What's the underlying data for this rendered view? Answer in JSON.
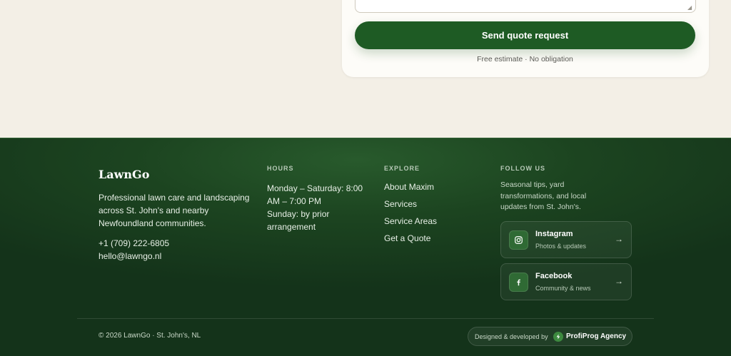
{
  "quote_form": {
    "submit_label": "Send quote request",
    "note": "Free estimate · No obligation"
  },
  "footer": {
    "brand": "LawnGo",
    "about": "Professional lawn care and landscaping across St. John's and nearby Newfoundland communities.",
    "phone": "+1 (709) 222-6805",
    "email": "hello@lawngo.nl",
    "hours": {
      "heading": "HOURS",
      "weekdays": "Monday – Saturday: 8:00 AM – 7:00 PM",
      "sunday": "Sunday: by prior arrangement"
    },
    "explore": {
      "heading": "EXPLORE",
      "links": [
        "About Maxim",
        "Services",
        "Service Areas",
        "Get a Quote"
      ]
    },
    "follow": {
      "heading": "FOLLOW US",
      "description": "Seasonal tips, yard transformations, and local updates from St. John's.",
      "instagram": {
        "title": "Instagram",
        "subtitle": "Photos & updates",
        "icon": "instagram-icon"
      },
      "facebook": {
        "title": "Facebook",
        "subtitle": "Community & news",
        "icon": "facebook-icon"
      },
      "arrow": "→"
    },
    "copyright": "© 2026 LawnGo · St. John's, NL",
    "credit": {
      "prefix": "Designed & developed by",
      "agency": "ProfiProg Agency"
    }
  },
  "colors": {
    "cream": "#f3efe6",
    "button_green": "#1e5b24",
    "footer_green": "#1c4420"
  }
}
